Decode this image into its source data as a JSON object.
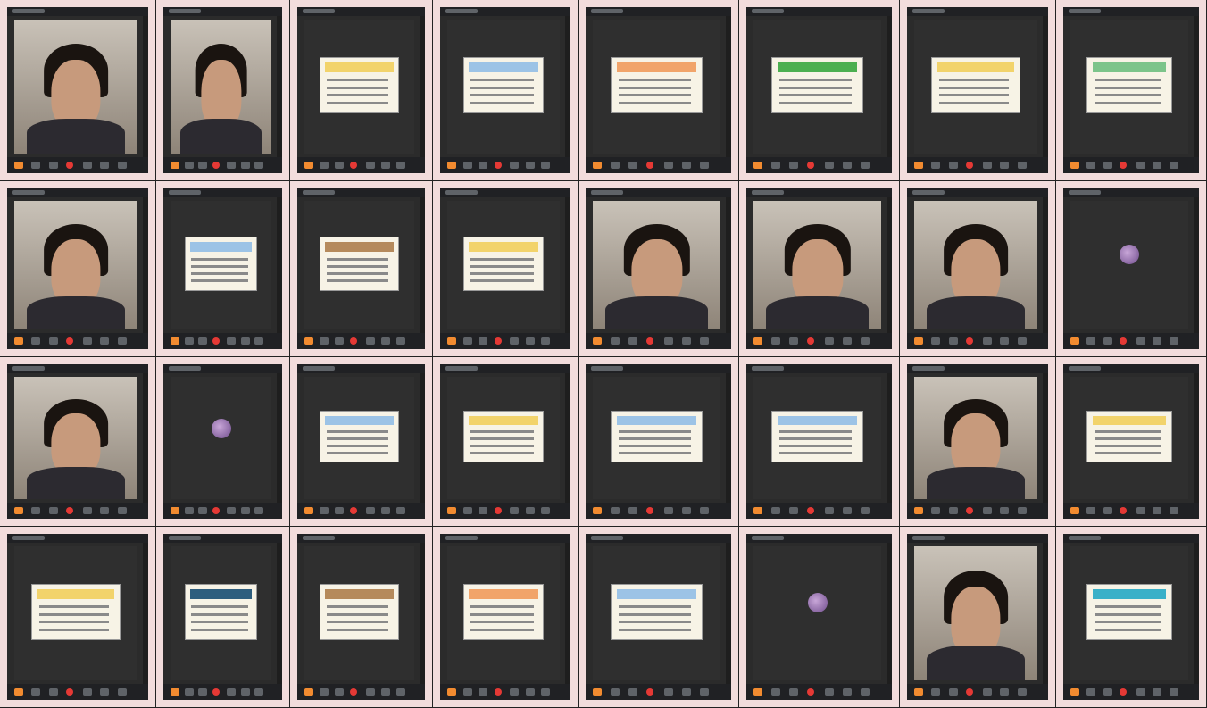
{
  "colors": {
    "cell_bg": "#f2dcdc",
    "meet_bg": "#2b2b2b",
    "toolbar": "#202124",
    "accent_orange": "#f28b30",
    "end_call_red": "#e53935"
  },
  "grid": {
    "rows": 4,
    "cols": 8,
    "tiles": [
      [
        "video-girl",
        "video-girl",
        "slide-yellow",
        "slide-blue",
        "slide-orange",
        "slide-excel",
        "slide-yellow",
        "slide-green"
      ],
      [
        "video-girl",
        "slide-blue",
        "slide-frame",
        "slide-yellow",
        "video-girl",
        "video-girl",
        "video-girl",
        "avatar"
      ],
      [
        "video-girl",
        "avatar",
        "slide-blue",
        "slide-yellow",
        "slide-blue",
        "slide-blue",
        "video-girl",
        "slide-yellow"
      ],
      [
        "slide-yellow",
        "slide-brown",
        "slide-frame",
        "slide-orange",
        "slide-blue",
        "avatar",
        "video-two",
        "slide-color"
      ]
    ]
  }
}
